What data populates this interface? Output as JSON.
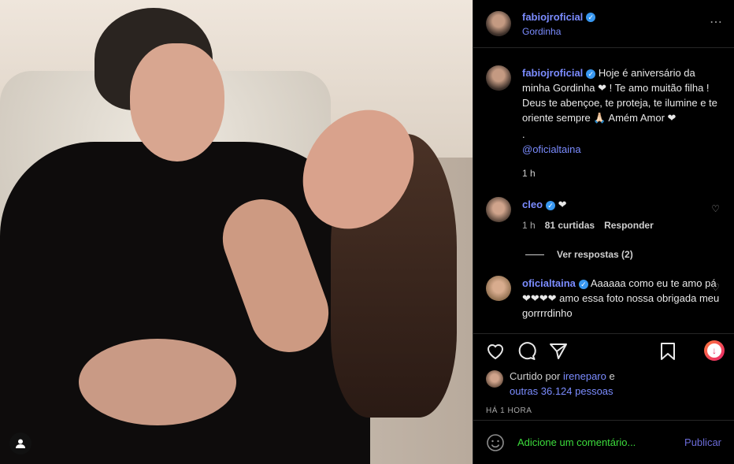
{
  "post": {
    "username": "fabiojroficial",
    "location": "Gordinha",
    "more_icon": "⋯"
  },
  "caption": {
    "username": "fabiojroficial",
    "text": "Hoje é aniversário da minha Gordinha ❤ ! Te amo muitão filha ! Deus te abençoe, te proteja, te ilumine e te oriente sempre 🙏🏻 Amém Amor ❤",
    "dot": ".",
    "mention": "@oficialtaina",
    "time": "1 h"
  },
  "comments": [
    {
      "username": "cleo",
      "text": "❤",
      "time": "1 h",
      "likes": "81 curtidas",
      "reply": "Responder",
      "view_replies": "Ver respostas (2)"
    },
    {
      "username": "oficialtaina",
      "text": "Aaaaaa como eu te amo pá ❤❤❤❤ amo essa foto nossa obrigada meu gorrrrdinho"
    }
  ],
  "likes": {
    "prefix": "Curtido por",
    "user": "ireneparo",
    "conj": "e",
    "others": "outras 36.124 pessoas"
  },
  "timestamp": "HÁ 1 HORA",
  "add_comment": {
    "placeholder": "Adicione um comentário...",
    "publish": "Publicar"
  },
  "colors": {
    "accent": "#7b8cff",
    "verified": "#3897f0",
    "placeholder": "#3cdc3c",
    "background": "#000000"
  }
}
